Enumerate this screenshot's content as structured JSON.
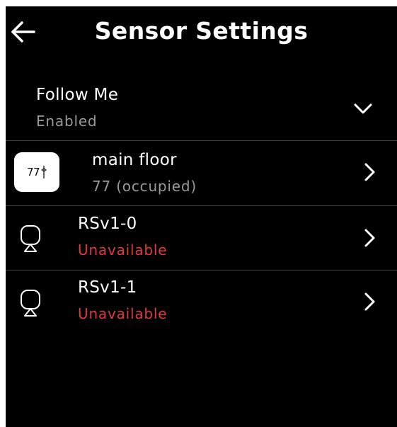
{
  "header": {
    "title": "Sensor Settings",
    "back_icon": "arrow-left-icon"
  },
  "follow_me": {
    "title": "Follow Me",
    "status": "Enabled",
    "expand_icon": "chevron-down-icon"
  },
  "thermostat": {
    "icon_value": "77",
    "name": "main floor",
    "status": "77 (occupied)",
    "icon": "thermostat-icon"
  },
  "sensors": [
    {
      "name": "RSv1-0",
      "status": "Unavailable",
      "icon": "remote-sensor-icon"
    },
    {
      "name": "RSv1-1",
      "status": "Unavailable",
      "icon": "remote-sensor-icon"
    }
  ],
  "colors": {
    "background": "#000000",
    "text": "#ffffff",
    "secondary_text": "#9a9a9a",
    "unavailable": "#e0393e",
    "divider": "#3d3d3d"
  }
}
